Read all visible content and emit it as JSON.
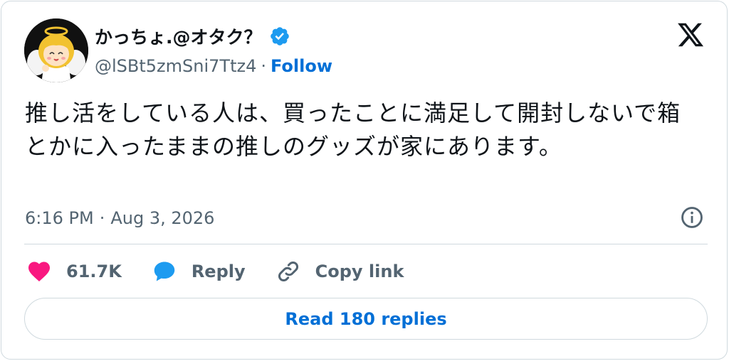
{
  "author": {
    "display_name": "かっちょ.@オタク？",
    "handle": "@lSBt5zmSni7Ttz4",
    "separator": "·",
    "follow_label": "Follow",
    "verified": true
  },
  "tweet": {
    "text": "推し活をしている人は、買ったことに満足して開封しないで箱とかに入ったままの推しのグッズが家にあります。",
    "time": "6:16 PM",
    "dot": "·",
    "date": "Aug 3, 2026"
  },
  "actions": {
    "like_count": "61.7K",
    "reply_label": "Reply",
    "copy_link_label": "Copy link"
  },
  "read_replies_label": "Read 180 replies",
  "icons": [
    "avatar-angel",
    "verified-badge-icon",
    "x-logo-icon",
    "info-icon",
    "heart-icon",
    "reply-bubble-icon",
    "link-icon"
  ],
  "colors": {
    "accent": "#006fd6",
    "verified": "#1d9bf0",
    "heart": "#f91880",
    "muted": "#536471",
    "border": "#cfd9de"
  }
}
